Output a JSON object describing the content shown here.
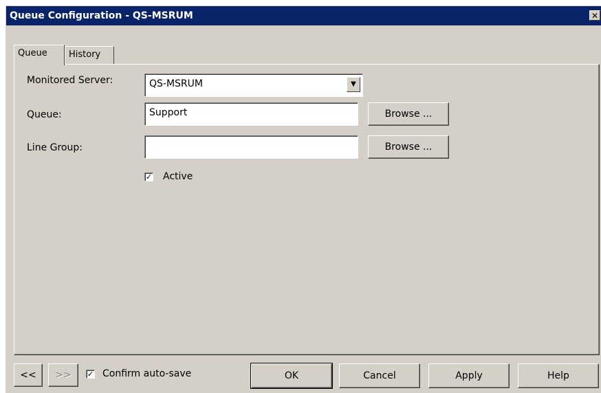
{
  "window": {
    "title": "Queue Configuration - QS-MSRUM",
    "close_glyph": "✕"
  },
  "tabs": [
    {
      "label": "Queue",
      "active": true
    },
    {
      "label": "History",
      "active": false
    }
  ],
  "form": {
    "monitored_server_label": "Monitored Server:",
    "monitored_server_value": "QS-MSRUM",
    "queue_label": "Queue:",
    "queue_value": "Support",
    "queue_browse": "Browse ...",
    "line_group_label": "Line Group:",
    "line_group_value": "",
    "line_group_browse": "Browse ...",
    "active_label": "Active",
    "active_checked": true
  },
  "footer": {
    "prev_label": "<<",
    "next_label": ">>",
    "confirm_autosave_label": "Confirm auto-save",
    "confirm_autosave_checked": true,
    "ok_label": "OK",
    "cancel_label": "Cancel",
    "apply_label": "Apply",
    "help_label": "Help"
  },
  "colors": {
    "titlebar": "#0a246a",
    "face": "#d4d0c8"
  },
  "icons": {
    "close": "close-icon",
    "dropdown": "chevron-down-icon",
    "check": "checkmark-icon"
  }
}
